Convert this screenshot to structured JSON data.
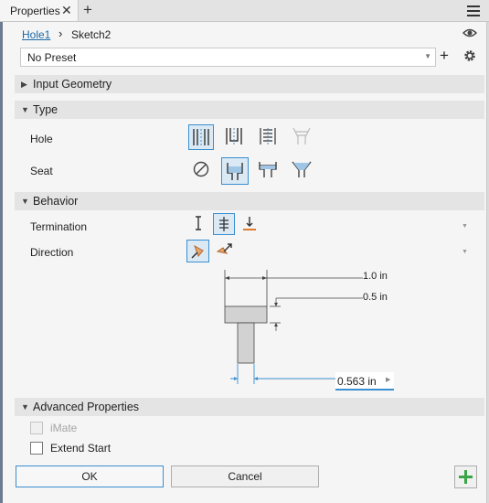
{
  "tab": {
    "title": "Properties",
    "close": "✕",
    "add": "+"
  },
  "breadcrumb": {
    "parent": "Hole1",
    "separator": "›",
    "child": "Sketch2"
  },
  "preset": {
    "value": "No Preset",
    "add": "+"
  },
  "sections": {
    "input_geometry": "Input Geometry",
    "type": "Type",
    "behavior": "Behavior",
    "advanced": "Advanced Properties"
  },
  "type": {
    "hole_label": "Hole",
    "seat_label": "Seat",
    "hole_options": [
      "simple-hole-icon",
      "clearance-hole-icon",
      "tapped-hole-icon",
      "taper-tapped-hole-icon"
    ],
    "hole_selected": "simple-hole-icon",
    "seat_options": [
      "none-icon",
      "counterbore-icon",
      "spotface-icon",
      "countersink-icon"
    ],
    "seat_selected": "counterbore-icon"
  },
  "behavior": {
    "termination_label": "Termination",
    "direction_label": "Direction",
    "termination_options": [
      "distance-icon",
      "through-all-icon",
      "to-icon"
    ],
    "termination_selected": "through-all-icon",
    "direction_options": [
      "default-direction-icon",
      "flip-direction-icon"
    ],
    "direction_selected": "default-direction-icon"
  },
  "diagram": {
    "cbore_diameter": "1.0 in",
    "cbore_depth": "0.5 in",
    "hole_diameter": "0.563 in"
  },
  "advanced": {
    "imate_label": "iMate",
    "imate_checked": false,
    "imate_disabled": true,
    "extend_start_label": "Extend Start",
    "extend_start_checked": false
  },
  "buttons": {
    "ok": "OK",
    "cancel": "Cancel",
    "apply": "+"
  },
  "colors": {
    "accent": "#3a8fd0",
    "apply_green": "#3aa447",
    "orange": "#e07a2e"
  }
}
